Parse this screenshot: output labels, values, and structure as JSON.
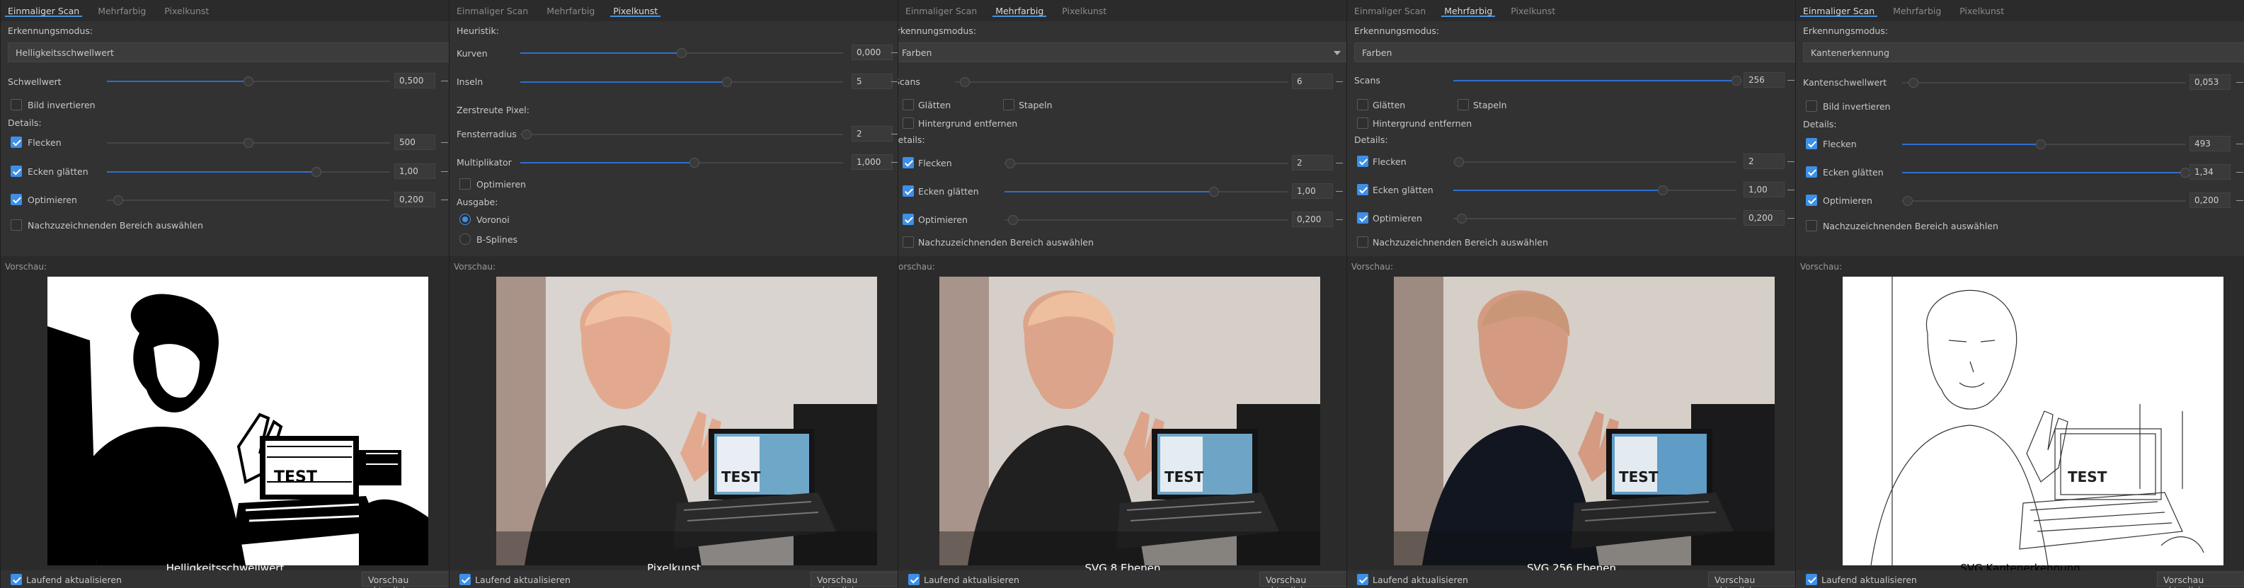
{
  "common": {
    "tabs": [
      "Einmaliger Scan",
      "Mehrfarbig",
      "Pixelkunst"
    ],
    "preview_label": "Vorschau:",
    "preview_label_cut": "Vorschau:",
    "live_update_label": "Laufend aktualisieren",
    "refresh_button_label": "Vorschau aktualisieren",
    "erkennungsmodus": "Erkennungsmodus:",
    "details": "Details:",
    "flecken": "Flecken",
    "ecken_glaetten": "Ecken glätten",
    "optimieren": "Optimieren",
    "nachzuzeichnenden": "Nachzuzeichnenden Bereich auswählen",
    "bild_invertieren": "Bild invertieren",
    "scans": "Scans",
    "glaetten": "Glätten",
    "stapeln": "Stapeln",
    "hintergrund": "Hintergrund entfernen"
  },
  "panel1": {
    "mode_value": "Helligkeitsschwellwert",
    "schwellwert_label": "Schwellwert",
    "schwellwert_value": "0,500",
    "flecken_value": "500",
    "ecken_value": "1,00",
    "optimieren_value": "0,200",
    "caption": "Helligkeitsschwellwert"
  },
  "panel2": {
    "heuristik": "Heuristik:",
    "kurven_label": "Kurven",
    "kurven_value": "0,000",
    "inseln_label": "Inseln",
    "inseln_value": "5",
    "zerstreute": "Zerstreute Pixel:",
    "fensterradius_label": "Fensterradius",
    "fensterradius_value": "2",
    "multiplikator_label": "Multiplikator",
    "multiplikator_value": "1,000",
    "optimieren_label": "Optimieren",
    "ausgabe": "Ausgabe:",
    "voronoi": "Voronoi",
    "bsplines": "B-Splines",
    "caption": "Pixelkunst"
  },
  "panel3": {
    "mode_value": "Farben",
    "scans_value": "6",
    "flecken_value": "2",
    "ecken_value": "1,00",
    "optimieren_value": "0,200",
    "preview_label": "/orschau:",
    "caption": "SVG 8 Ebenen"
  },
  "panel4": {
    "mode_value": "Farben",
    "scans_value": "256",
    "flecken_value": "2",
    "ecken_value": "1,00",
    "optimieren_value": "0,200",
    "caption": "SVG 256 Ebenen"
  },
  "panel5": {
    "mode_value": "Kantenerkennung",
    "schwellwert_label": "Kantenschwellwert",
    "schwellwert_value": "0,053",
    "flecken_value": "493",
    "ecken_value": "1,34",
    "optimieren_value": "0,200",
    "caption": "SVG Kantenerkennung"
  },
  "preview_texts": {
    "screen_text": "TEST"
  }
}
